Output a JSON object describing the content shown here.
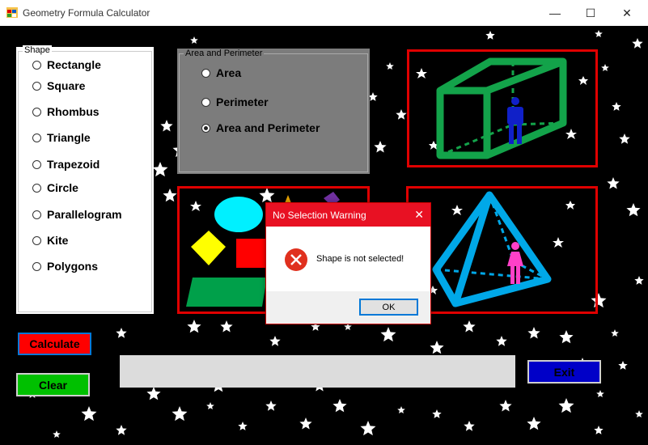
{
  "window": {
    "title": "Geometry Formula Calculator",
    "minimize_glyph": "—",
    "maximize_glyph": "☐",
    "close_glyph": "✕"
  },
  "shape_group": {
    "legend": "Shape",
    "options": [
      "Rectangle",
      "Square",
      "Rhombus",
      "Triangle",
      "Trapezoid",
      "Circle",
      "Parallelogram",
      "Kite",
      "Polygons"
    ]
  },
  "calc_group": {
    "legend": "Area and Perimeter",
    "options": [
      "Area",
      "Perimeter",
      "Area and Perimeter"
    ],
    "selected": "Area and Perimeter"
  },
  "buttons": {
    "calculate": "Calculate",
    "clear": "Clear",
    "exit": "Exit"
  },
  "colors": {
    "calculate_bg": "#ff0000",
    "clear_bg": "#00c000",
    "exit_bg": "#0000c8",
    "frame_red": "#e00000"
  },
  "dialog": {
    "title": "No Selection Warning",
    "message": "Shape is not selected!",
    "ok_label": "OK",
    "close_glyph": "✕"
  }
}
